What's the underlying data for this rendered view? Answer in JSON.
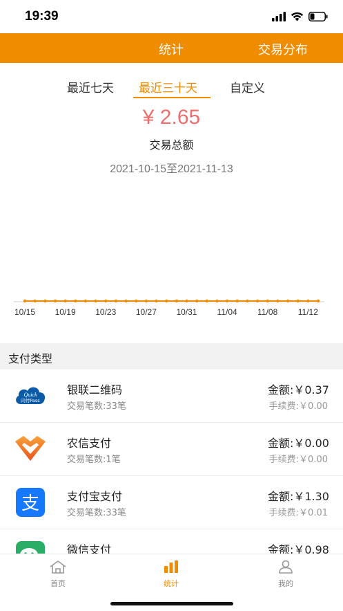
{
  "status_bar": {
    "time": "19:39",
    "battery_level": 0.3
  },
  "top_nav": {
    "tabs": [
      {
        "label": "统计"
      },
      {
        "label": "交易分布"
      }
    ]
  },
  "range_tabs": {
    "items": [
      {
        "label": "最近七天"
      },
      {
        "label": "最近三十天"
      },
      {
        "label": "自定义"
      }
    ],
    "selected": "最近三十天"
  },
  "summary": {
    "amount": "¥ 2.65",
    "amount_label": "交易总额",
    "date_range": "2021-10-15至2021-11-13"
  },
  "chart_data": {
    "type": "line",
    "x": [
      "10/15",
      "10/16",
      "10/17",
      "10/18",
      "10/19",
      "10/20",
      "10/21",
      "10/22",
      "10/23",
      "10/24",
      "10/25",
      "10/26",
      "10/27",
      "10/28",
      "10/29",
      "10/30",
      "10/31",
      "11/01",
      "11/02",
      "11/03",
      "11/04",
      "11/05",
      "11/06",
      "11/07",
      "11/08",
      "11/09",
      "11/10",
      "11/11",
      "11/12",
      "11/13"
    ],
    "tick_labels": [
      "10/15",
      "10/19",
      "10/23",
      "10/27",
      "10/31",
      "11/04",
      "11/08",
      "11/12"
    ],
    "values": [
      0,
      0,
      0,
      0,
      0,
      0,
      0,
      0,
      0,
      0,
      0,
      0,
      0,
      0,
      0,
      0,
      0,
      0,
      0,
      0,
      0,
      0,
      0,
      0,
      0,
      0,
      0,
      0,
      0,
      0
    ],
    "color": "#f08c00",
    "title": "",
    "xlabel": "",
    "ylabel": "",
    "grid": false
  },
  "section": {
    "title": "支付类型"
  },
  "payments": [
    {
      "name": "银联二维码",
      "count": "交易笔数:33笔",
      "amount": "金额:￥0.37",
      "fee": "手续费:￥0.00",
      "icon": "unionpay-quickpass-icon",
      "icon_text_1": "Quick",
      "icon_text_2": "闪付Pass"
    },
    {
      "name": "农信支付",
      "count": "交易笔数:1笔",
      "amount": "金额:￥0.00",
      "fee": "手续费:￥0.00",
      "icon": "rural-credit-pay-icon"
    },
    {
      "name": "支付宝支付",
      "count": "交易笔数:33笔",
      "amount": "金额:￥1.30",
      "fee": "手续费:￥0.01",
      "icon": "alipay-icon",
      "icon_text_1": "支"
    },
    {
      "name": "微信支付",
      "count": "",
      "amount": "金额:￥0.98",
      "fee": "",
      "icon": "wechat-pay-icon"
    }
  ],
  "bottom_nav": {
    "items": [
      {
        "label": "首页",
        "icon": "home-icon"
      },
      {
        "label": "统计",
        "icon": "bar-chart-icon"
      },
      {
        "label": "我的",
        "icon": "user-icon"
      }
    ],
    "selected": "统计"
  },
  "colors": {
    "accent": "#f08c00",
    "amount": "#e9706e",
    "alipay": "#1677ff",
    "wechat": "#2aae67",
    "unionpay": "#0b5aa6"
  }
}
